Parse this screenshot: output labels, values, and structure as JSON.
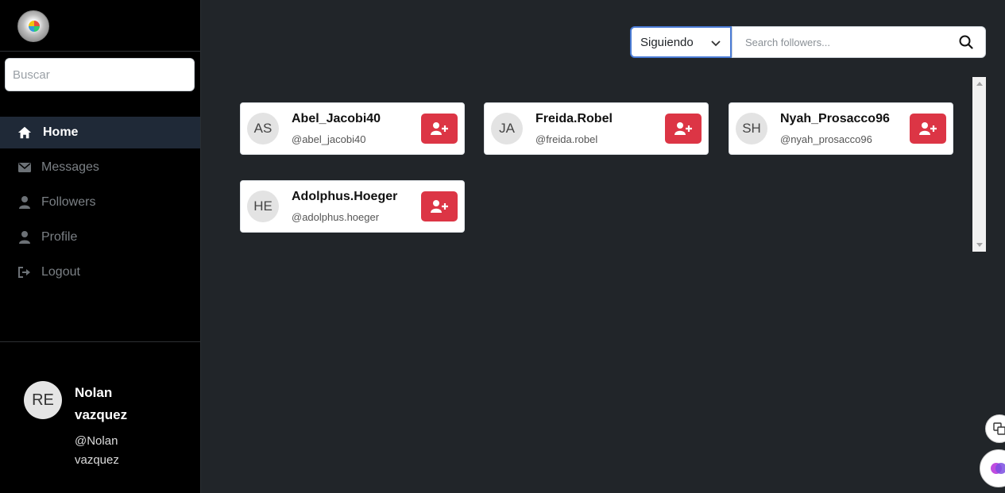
{
  "sidebar": {
    "search_placeholder": "Buscar",
    "nav": [
      {
        "label": "Home",
        "icon": "home-icon",
        "active": true
      },
      {
        "label": "Messages",
        "icon": "envelope-icon"
      },
      {
        "label": "Followers",
        "icon": "user-icon"
      },
      {
        "label": "Profile",
        "icon": "user-icon"
      },
      {
        "label": "Logout",
        "icon": "logout-icon"
      }
    ],
    "user": {
      "initials": "RE",
      "name": "Nolan vazquez",
      "handle": "@Nolan vazquez"
    }
  },
  "toolbar": {
    "filter_value": "Siguiendo",
    "search_placeholder": "Search followers..."
  },
  "followers": [
    {
      "initials": "AS",
      "name": "Abel_Jacobi40",
      "handle": "@abel_jacobi40"
    },
    {
      "initials": "JA",
      "name": "Freida.Robel",
      "handle": "@freida.robel"
    },
    {
      "initials": "SH",
      "name": "Nyah_Prosacco96",
      "handle": "@nyah_prosacco96"
    },
    {
      "initials": "HE",
      "name": "Adolphus.Hoeger",
      "handle": "@adolphus.hoeger"
    }
  ],
  "colors": {
    "sidebar_bg": "#000000",
    "main_bg": "#212529",
    "active_nav_bg": "#1f2937",
    "follow_button": "#dc3545",
    "select_border": "#4a7bd5"
  }
}
